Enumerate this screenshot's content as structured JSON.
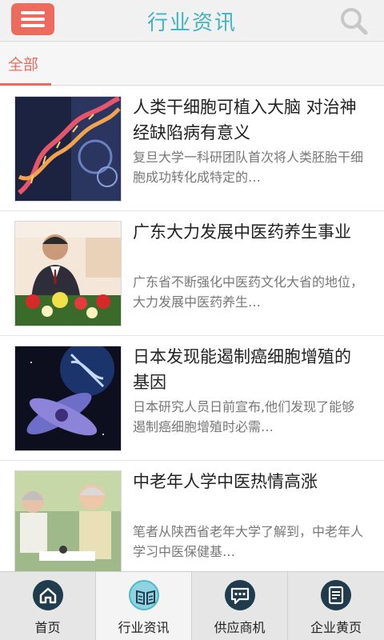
{
  "header": {
    "title": "行业资讯",
    "menu_icon": "menu-icon",
    "search_icon": "search-icon"
  },
  "tabs": [
    {
      "label": "全部",
      "active": true
    }
  ],
  "news": [
    {
      "title": "人类干细胞可植入大脑 对治神经缺陷病有意义",
      "summary": "复旦大学一科研团队首次将人类胚胎干细胞成功转化成特定的…",
      "image": "dna-helix-image"
    },
    {
      "title": "广东大力发展中医药养生事业",
      "summary": "广东省不断强化中医药文化大省的地位，大力发展中医药养生…",
      "image": "speaker-podium-image"
    },
    {
      "title": "日本发现能遏制癌细胞增殖的基因",
      "summary": "日本研究人员日前宣布,他们发现了能够遏制癌细胞增殖时必需…",
      "image": "chromosome-image"
    },
    {
      "title": "中老年人学中医热情高涨",
      "summary": "笔者从陕西省老年大学了解到，中老年人学习中医保健基…",
      "image": "elderly-couple-image"
    }
  ],
  "bottom_nav": [
    {
      "label": "首页",
      "icon": "home-icon",
      "active": false
    },
    {
      "label": "行业资讯",
      "icon": "book-icon",
      "active": true
    },
    {
      "label": "供应商机",
      "icon": "chat-icon",
      "active": false
    },
    {
      "label": "企业黄页",
      "icon": "document-icon",
      "active": false
    }
  ],
  "colors": {
    "accent": "#ec6a5e",
    "title": "#3fb4c4",
    "nav_icon": "#1f3b4c"
  }
}
